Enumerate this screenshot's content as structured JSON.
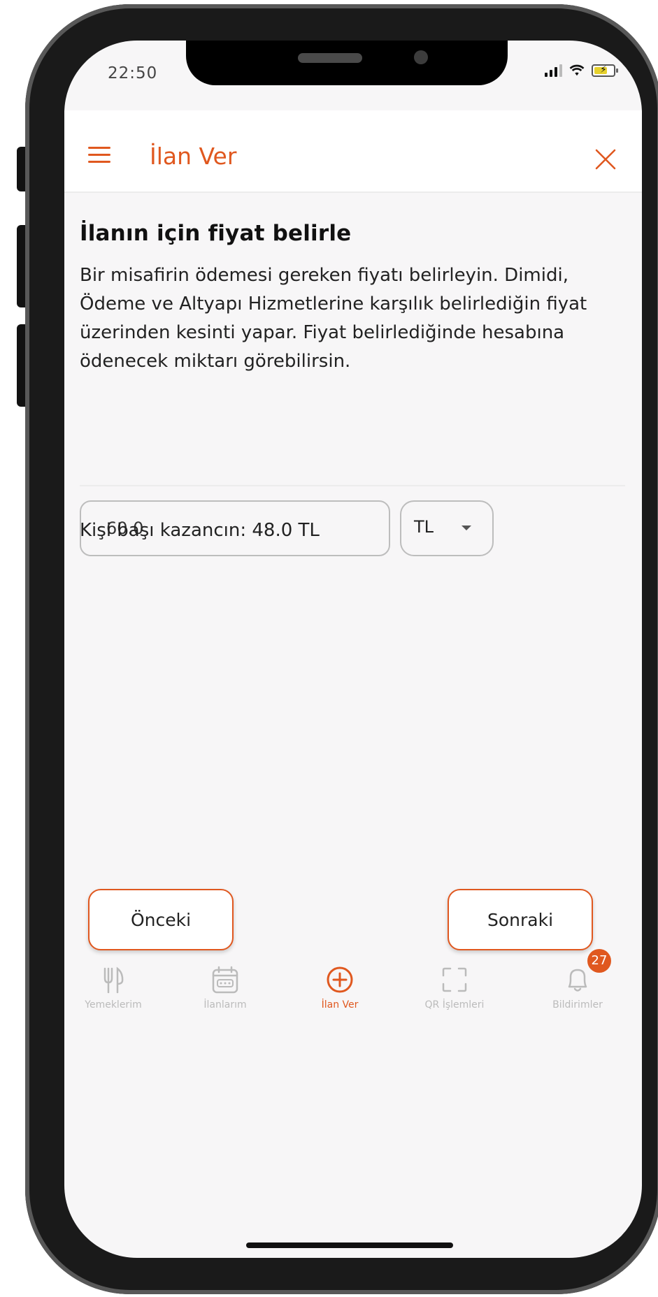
{
  "status_bar": {
    "time": "22:50"
  },
  "header": {
    "title": "İlan Ver"
  },
  "main": {
    "title": "İlanın için fiyat belirle",
    "description": "Bir misafirin ödemesi gereken fiyatı belirleyin. Dimidi, Ödeme ve Altyapı  Hizmetlerine karşılık belirlediğin fiyat üzerinden kesinti yapar.  Fiyat belirlediğinde hesabına ödenecek miktarı görebilirsin.",
    "price_value": "60.0",
    "currency": "TL",
    "earnings_text": "Kişi başı kazancın: 48.0 TL"
  },
  "buttons": {
    "previous": "Önceki",
    "next": "Sonraki"
  },
  "tabs": [
    {
      "label": "Yemeklerim",
      "icon": "fork-knife-icon"
    },
    {
      "label": "İlanlarım",
      "icon": "calendar-icon"
    },
    {
      "label": "İlan Ver",
      "icon": "plus-circle-icon"
    },
    {
      "label": "QR İşlemleri",
      "icon": "qr-frame-icon"
    },
    {
      "label": "Bildirimler",
      "icon": "bell-icon"
    }
  ],
  "notifications_badge": "27",
  "colors": {
    "accent": "#e0581f",
    "inactive": "#bbbbbb"
  }
}
